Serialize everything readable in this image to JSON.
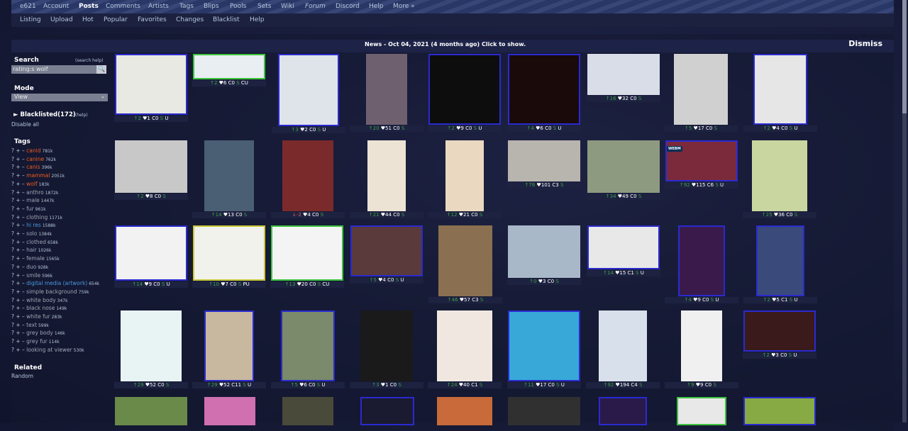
{
  "nav": {
    "main": [
      "e621",
      "Account",
      "Posts",
      "Comments",
      "Artists",
      "Tags",
      "Blips",
      "Pools",
      "Sets",
      "Wiki",
      "Forum",
      "Discord",
      "Help",
      "More »"
    ],
    "sub": [
      "Listing",
      "Upload",
      "Hot",
      "Popular",
      "Favorites",
      "Changes",
      "Blacklist",
      "Help"
    ]
  },
  "news": {
    "text": "News - Oct 04, 2021 (4 months ago) Click to show.",
    "dismiss": "Dismiss"
  },
  "sidebar": {
    "search_title": "Search",
    "search_help": "(search help)",
    "search_value": "rating:s wolf",
    "mode_title": "Mode",
    "mode_value": "View",
    "blacklisted": "► Blacklisted(172)",
    "blacklisted_help": "(help)",
    "disable_all": "Disable all",
    "tags_title": "Tags",
    "related_title": "Related",
    "related_link": "Random",
    "tags": [
      {
        "name": "canid",
        "count": "781k",
        "type": "species"
      },
      {
        "name": "canine",
        "count": "762k",
        "type": "species"
      },
      {
        "name": "canis",
        "count": "396k",
        "type": "species"
      },
      {
        "name": "mammal",
        "count": "2051k",
        "type": "species"
      },
      {
        "name": "wolf",
        "count": "183k",
        "type": "species"
      },
      {
        "name": "anthro",
        "count": "1872k",
        "type": "general"
      },
      {
        "name": "male",
        "count": "1447k",
        "type": "general"
      },
      {
        "name": "fur",
        "count": "961k",
        "type": "general"
      },
      {
        "name": "clothing",
        "count": "1171k",
        "type": "general"
      },
      {
        "name": "hi res",
        "count": "1588k",
        "type": "meta"
      },
      {
        "name": "solo",
        "count": "1384k",
        "type": "general"
      },
      {
        "name": "clothed",
        "count": "658k",
        "type": "general"
      },
      {
        "name": "hair",
        "count": "1026k",
        "type": "general"
      },
      {
        "name": "female",
        "count": "1565k",
        "type": "general"
      },
      {
        "name": "duo",
        "count": "928k",
        "type": "general"
      },
      {
        "name": "smile",
        "count": "596k",
        "type": "general"
      },
      {
        "name": "digital media (artwork)",
        "count": "654k",
        "type": "meta"
      },
      {
        "name": "simple background",
        "count": "759k",
        "type": "general"
      },
      {
        "name": "white body",
        "count": "347k",
        "type": "general"
      },
      {
        "name": "black nose",
        "count": "149k",
        "type": "general"
      },
      {
        "name": "white fur",
        "count": "283k",
        "type": "general"
      },
      {
        "name": "text",
        "count": "599k",
        "type": "general"
      },
      {
        "name": "grey body",
        "count": "146k",
        "type": "general"
      },
      {
        "name": "grey fur",
        "count": "114k",
        "type": "general"
      },
      {
        "name": "looking at viewer",
        "count": "530k",
        "type": "general"
      }
    ]
  },
  "posts": [
    {
      "score": "↑2",
      "fav": "♥1",
      "com": "C0",
      "rating": "S",
      "extra": "U",
      "bg": "#e9e9e4",
      "border": "#2a2ad0"
    },
    {
      "score": "↑2",
      "fav": "♥6",
      "com": "C0",
      "rating": "S",
      "extra": "CU",
      "bg": "#e8eef2",
      "border": "#3cc43c"
    },
    {
      "score": "↑3",
      "fav": "♥2",
      "com": "C0",
      "rating": "S",
      "extra": "U",
      "bg": "#dfe3ea",
      "border": "#2a2ad0"
    },
    {
      "score": "↑20",
      "fav": "♥51",
      "com": "C0",
      "rating": "S",
      "extra": "",
      "bg": "#6f6070",
      "border": ""
    },
    {
      "score": "↑2",
      "fav": "♥9",
      "com": "C0",
      "rating": "S",
      "extra": "U",
      "bg": "#0d0d0d",
      "border": "#2a2ad0"
    },
    {
      "score": "↑4",
      "fav": "♥6",
      "com": "C0",
      "rating": "S",
      "extra": "U",
      "bg": "#1a0a0a",
      "border": "#2a2ad0"
    },
    {
      "score": "↑16",
      "fav": "♥32",
      "com": "C0",
      "rating": "S",
      "extra": "",
      "bg": "#d8dde8",
      "border": ""
    },
    {
      "score": "↑5",
      "fav": "♥17",
      "com": "C0",
      "rating": "S",
      "extra": "",
      "bg": "#d0d0d0",
      "border": ""
    },
    {
      "score": "↑2",
      "fav": "♥4",
      "com": "C0",
      "rating": "S",
      "extra": "U",
      "bg": "#e6e6e6",
      "border": "#2a2ad0"
    },
    {
      "score": "↑2",
      "fav": "♥8",
      "com": "C0",
      "rating": "S",
      "extra": "",
      "bg": "#c8c8c8",
      "border": ""
    },
    {
      "score": "↑14",
      "fav": "♥13",
      "com": "C0",
      "rating": "S",
      "extra": "",
      "bg": "#4a5e74",
      "border": ""
    },
    {
      "score": "↓-2",
      "fav": "♥4",
      "com": "C0",
      "rating": "S",
      "extra": "",
      "bg": "#7a2a2a",
      "border": ""
    },
    {
      "score": "↑21",
      "fav": "♥44",
      "com": "C0",
      "rating": "S",
      "extra": "",
      "bg": "#ede3d4",
      "border": ""
    },
    {
      "score": "↑12",
      "fav": "♥21",
      "com": "C0",
      "rating": "S",
      "extra": "",
      "bg": "#ead9c0",
      "border": ""
    },
    {
      "score": "↑76",
      "fav": "♥101",
      "com": "C3",
      "rating": "S",
      "extra": "",
      "bg": "#b8b4ae",
      "border": ""
    },
    {
      "score": "↑34",
      "fav": "♥49",
      "com": "C0",
      "rating": "S",
      "extra": "",
      "bg": "#8d9a80",
      "border": ""
    },
    {
      "score": "↑92",
      "fav": "♥115",
      "com": "C6",
      "rating": "S",
      "extra": "U",
      "bg": "#7a2a3a",
      "border": "#2a2ad0"
    },
    {
      "score": "↑25",
      "fav": "♥36",
      "com": "C0",
      "rating": "S",
      "extra": "",
      "bg": "#c9d6a0",
      "border": ""
    },
    {
      "score": "↑14",
      "fav": "♥9",
      "com": "C0",
      "rating": "S",
      "extra": "U",
      "bg": "#f2f2f2",
      "border": "#2a2ad0"
    },
    {
      "score": "↑10",
      "fav": "♥7",
      "com": "C0",
      "rating": "S",
      "extra": "PU",
      "bg": "#f2f2ec",
      "border": "#c8c838"
    },
    {
      "score": "↑13",
      "fav": "♥20",
      "com": "C0",
      "rating": "S",
      "extra": "CU",
      "bg": "#f4f4f4",
      "border": "#3cc43c"
    },
    {
      "score": "↑5",
      "fav": "♥4",
      "com": "C0",
      "rating": "S",
      "extra": "U",
      "bg": "#5a3a3a",
      "border": "#2a2ad0"
    },
    {
      "score": "↑46",
      "fav": "♥57",
      "com": "C3",
      "rating": "S",
      "extra": "",
      "bg": "#8a7050",
      "border": ""
    },
    {
      "score": "↑0",
      "fav": "♥3",
      "com": "C0",
      "rating": "S",
      "extra": "",
      "bg": "#a8b8c8",
      "border": ""
    },
    {
      "score": "↑14",
      "fav": "♥15",
      "com": "C1",
      "rating": "S",
      "extra": "U",
      "bg": "#e8e8e8",
      "border": "#2a2ad0"
    },
    {
      "score": "↑4",
      "fav": "♥9",
      "com": "C0",
      "rating": "S",
      "extra": "U",
      "bg": "#3a1a4a",
      "border": "#2a2ad0"
    },
    {
      "score": "↑2",
      "fav": "♥5",
      "com": "C1",
      "rating": "S",
      "extra": "U",
      "bg": "#3a4a7a",
      "border": "#2a2ad0"
    },
    {
      "score": "↑29",
      "fav": "♥52",
      "com": "C0",
      "rating": "S",
      "extra": "",
      "bg": "#e8f4f4",
      "border": ""
    },
    {
      "score": "↑29",
      "fav": "♥52",
      "com": "C11",
      "rating": "S",
      "extra": "U",
      "bg": "#c8b8a0",
      "border": "#2a2ad0"
    },
    {
      "score": "↑5",
      "fav": "♥6",
      "com": "C0",
      "rating": "S",
      "extra": "U",
      "bg": "#7a8a6a",
      "border": "#2a2ad0"
    },
    {
      "score": "↑3",
      "fav": "♥1",
      "com": "C0",
      "rating": "S",
      "extra": "",
      "bg": "#1a1a1a",
      "border": ""
    },
    {
      "score": "↑24",
      "fav": "♥40",
      "com": "C1",
      "rating": "S",
      "extra": "",
      "bg": "#f0e8e0",
      "border": ""
    },
    {
      "score": "↑11",
      "fav": "♥17",
      "com": "C0",
      "rating": "S",
      "extra": "U",
      "bg": "#38a8d8",
      "border": "#2a2ad0"
    },
    {
      "score": "↑92",
      "fav": "♥194",
      "com": "C4",
      "rating": "S",
      "extra": "",
      "bg": "#d8e0ec",
      "border": ""
    },
    {
      "score": "↑9",
      "fav": "♥9",
      "com": "C0",
      "rating": "S",
      "extra": "",
      "bg": "#f0f0f0",
      "border": ""
    },
    {
      "score": "↑2",
      "fav": "♥3",
      "com": "C0",
      "rating": "S",
      "extra": "U",
      "bg": "#3a1a1a",
      "border": "#2a2ad0"
    },
    {
      "score": "",
      "fav": "",
      "com": "",
      "rating": "",
      "extra": "",
      "bg": "#6a8a4a",
      "border": ""
    },
    {
      "score": "",
      "fav": "",
      "com": "",
      "rating": "",
      "extra": "",
      "bg": "#d070b0",
      "border": ""
    },
    {
      "score": "",
      "fav": "",
      "com": "",
      "rating": "",
      "extra": "",
      "bg": "#4a4a3a",
      "border": ""
    },
    {
      "score": "",
      "fav": "",
      "com": "",
      "rating": "",
      "extra": "",
      "bg": "#1a1a30",
      "border": "#2a2ad0"
    },
    {
      "score": "",
      "fav": "",
      "com": "",
      "rating": "",
      "extra": "",
      "bg": "#c86a3a",
      "border": ""
    },
    {
      "score": "",
      "fav": "",
      "com": "",
      "rating": "",
      "extra": "",
      "bg": "#303030",
      "border": ""
    },
    {
      "score": "",
      "fav": "",
      "com": "",
      "rating": "",
      "extra": "",
      "bg": "#2a1a4a",
      "border": "#2a2ad0"
    },
    {
      "score": "",
      "fav": "",
      "com": "",
      "rating": "",
      "extra": "",
      "bg": "#e8e8e8",
      "border": "#3cc43c"
    },
    {
      "score": "",
      "fav": "",
      "com": "",
      "rating": "",
      "extra": "",
      "bg": "#88aa44",
      "border": "#2a2ad0"
    }
  ],
  "webm_label": "WEBM"
}
